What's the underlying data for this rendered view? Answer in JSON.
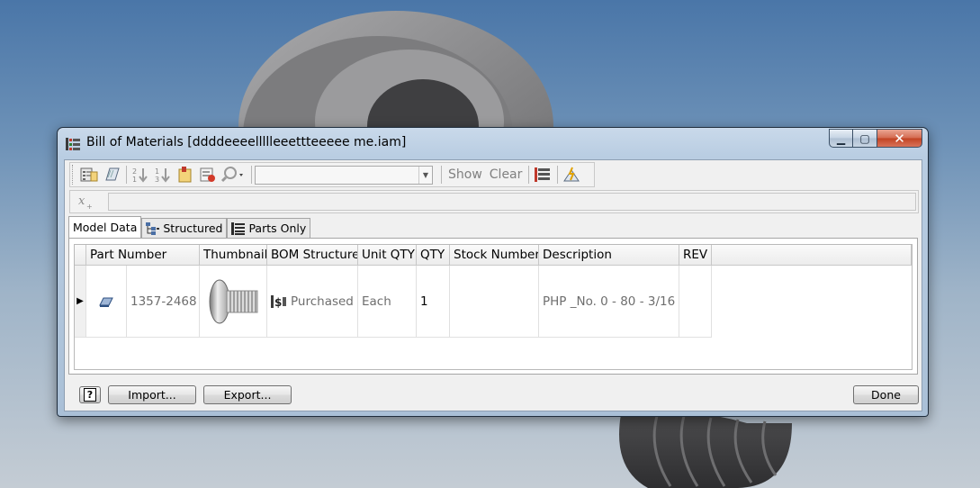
{
  "window": {
    "title": "Bill of Materials [ddddeeeellllleeettteeeee me.iam]",
    "buttons": {
      "minimize": "▁",
      "maximize": "▢",
      "close": "✕"
    }
  },
  "toolbar": {
    "icons": [
      "export-bom-icon",
      "copy-icon",
      "sort-ascending-icon",
      "sort-descending-icon",
      "bom-settings-icon",
      "renumber-icon",
      "find-icon"
    ],
    "combo_value": "",
    "show_label": "Show",
    "clear_label": "Clear",
    "extra_icons": [
      "bom-columns-icon",
      "update-mass-icon"
    ]
  },
  "formula_bar": {
    "value": ""
  },
  "tabs": [
    {
      "label": "Model Data",
      "active": true
    },
    {
      "label": "Structured",
      "active": false
    },
    {
      "label": "Parts Only",
      "active": false
    }
  ],
  "grid": {
    "columns": [
      "Part Number",
      "Thumbnail",
      "BOM Structure",
      "Unit QTY",
      "QTY",
      "Stock Number",
      "Description",
      "REV"
    ],
    "rows": [
      {
        "part_number": "1357-2468",
        "thumbnail": "screw-thumbnail",
        "bom_structure": "Purchased",
        "unit_qty": "Each",
        "qty": "1",
        "stock_number": "",
        "description": "PHP _No. 0 - 80 - 3/16",
        "rev": ""
      }
    ]
  },
  "buttons": {
    "help": "?",
    "import": "Import...",
    "export": "Export...",
    "done": "Done"
  }
}
